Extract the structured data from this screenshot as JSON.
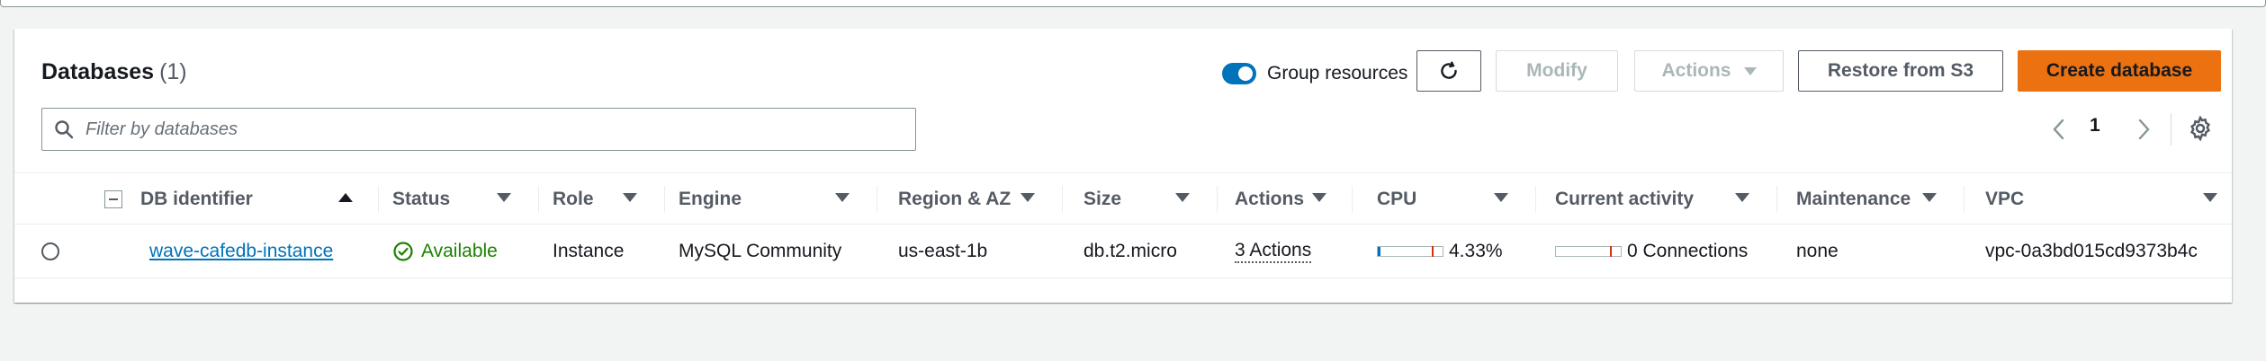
{
  "header": {
    "title": "Databases",
    "count": "(1)"
  },
  "toolbar": {
    "group_label": "Group resources",
    "group_enabled": true,
    "modify_label": "Modify",
    "actions_label": "Actions",
    "restore_label": "Restore from S3",
    "create_label": "Create database"
  },
  "search": {
    "placeholder": "Filter by databases"
  },
  "pagination": {
    "current_page": "1"
  },
  "table": {
    "columns": [
      "DB identifier",
      "Status",
      "Role",
      "Engine",
      "Region & AZ",
      "Size",
      "Actions",
      "CPU",
      "Current activity",
      "Maintenance",
      "VPC"
    ],
    "rows": [
      {
        "db_identifier": "wave-cafedb-instance",
        "status": "Available",
        "role": "Instance",
        "engine": "MySQL Community",
        "region_az": "us-east-1b",
        "size": "db.t2.micro",
        "actions": "3 Actions",
        "cpu": "4.33%",
        "cpu_fraction": 0.0433,
        "current_activity": "0 Connections",
        "maintenance": "none",
        "vpc": "vpc-0a3bd015cd9373b4c"
      }
    ]
  },
  "colors": {
    "accent": "#0073bb",
    "primary_button": "#ec7211",
    "status_ok": "#1d8102",
    "meter_marker": "#d13212"
  },
  "icons": {
    "refresh": "refresh-icon",
    "search": "search-icon",
    "prev": "chevron-left-icon",
    "next": "chevron-right-icon",
    "settings": "gear-icon",
    "status": "check-circle-icon"
  }
}
